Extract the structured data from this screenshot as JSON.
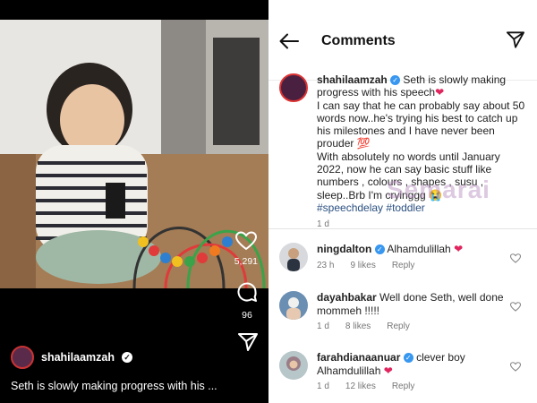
{
  "reel": {
    "username": "shahilaamzah",
    "caption_preview": "Seth is slowly making progress with his ...",
    "likes_count": "5,291",
    "comments_count": "96"
  },
  "comments_screen": {
    "title": "Comments",
    "post": {
      "username": "shahilaamzah",
      "text_line1": "Seth is slowly making progress with his speech",
      "text_line2": "I can say that he can probably say about 50 words now..he's trying his best to catch up his milestones and I have never been prouder",
      "emoji1": "💯",
      "text_line3": "With absolutely no words until January 2022, now he can say basic stuff like numbers , colours , shapes , susu , sleep..Brb I'm cryinggg",
      "emoji2": "😭",
      "hashtags": "#speechdelay #toddler",
      "time": "1 d"
    },
    "comments": [
      {
        "username": "ningdalton",
        "verified": true,
        "text": "Alhamdulillah",
        "time": "23 h",
        "likes": "9 likes",
        "reply": "Reply"
      },
      {
        "username": "dayahbakar",
        "verified": false,
        "text": "Well done Seth, well done mommeh !!!!!",
        "time": "1 d",
        "likes": "8 likes",
        "reply": "Reply"
      },
      {
        "username": "farahdianaanuar",
        "verified": true,
        "text": "clever boy Alhamdulillah",
        "time": "1 d",
        "likes": "12 likes",
        "reply": "Reply"
      }
    ],
    "watermark": "Semarai"
  },
  "colors": {
    "accent_heart": "#e0245e",
    "hashtag": "#2a4f80",
    "dark_bg": "#000000"
  },
  "icons": [
    "back-arrow-icon",
    "send-icon",
    "heart-icon",
    "comment-icon",
    "share-icon",
    "verified-badge-icon"
  ]
}
